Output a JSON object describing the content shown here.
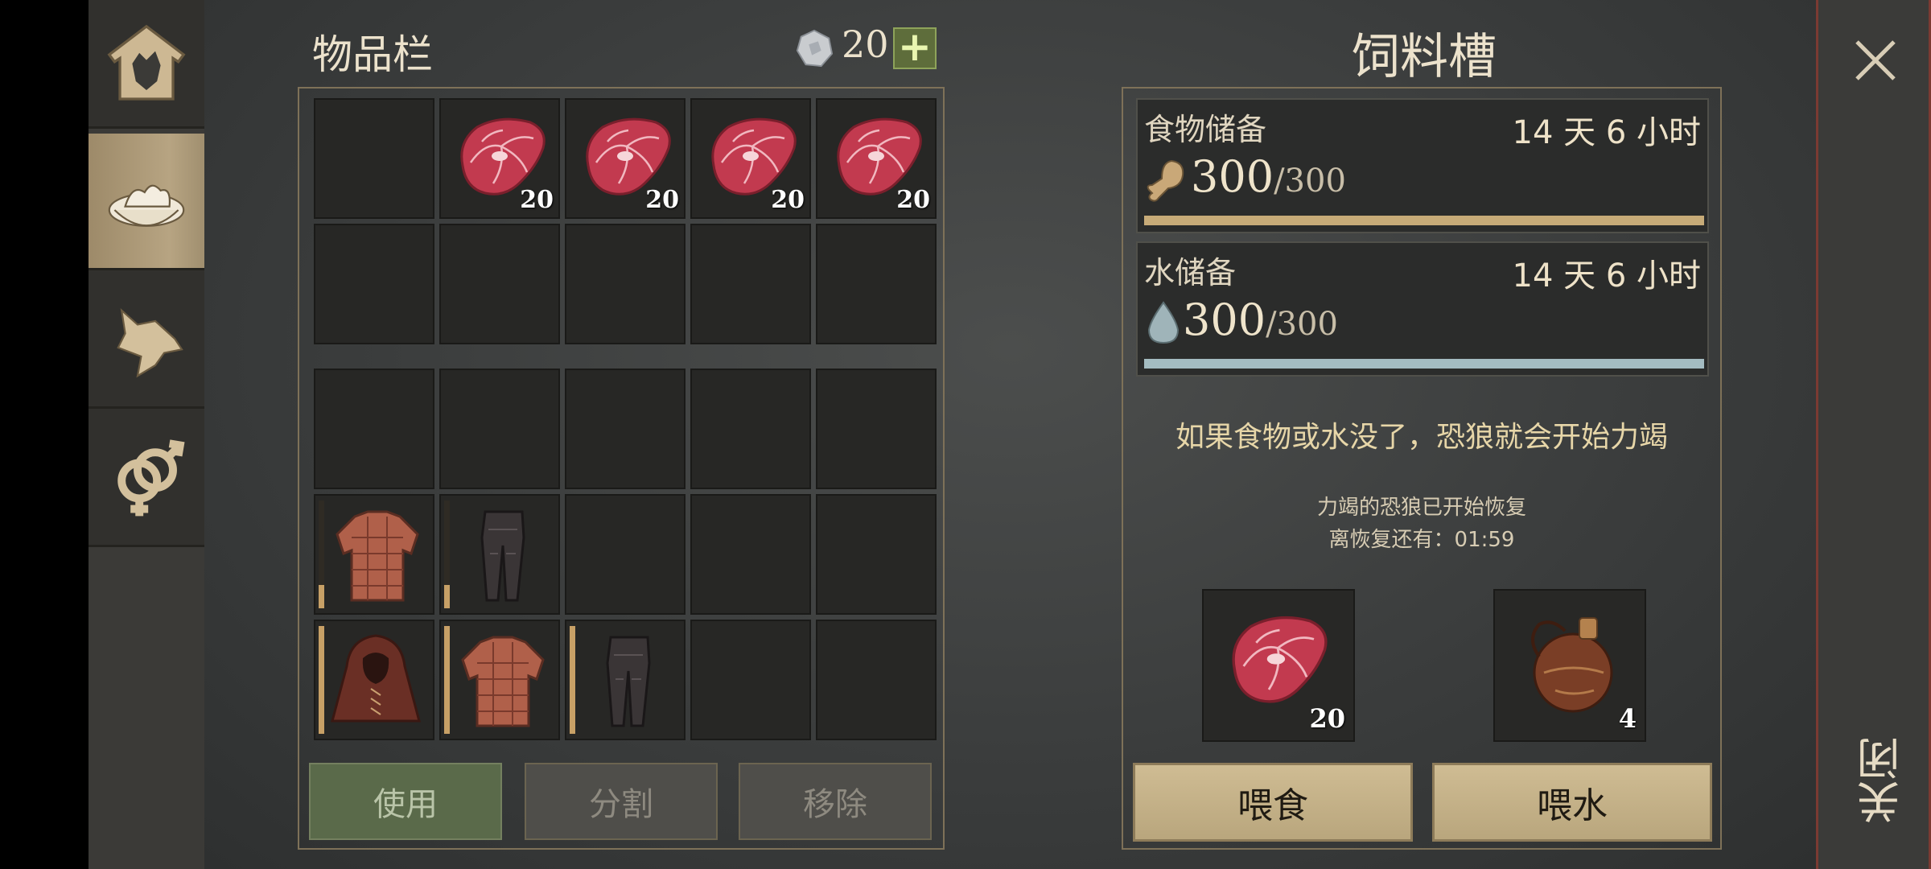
{
  "inventory": {
    "title": "物品栏",
    "currency": "20",
    "plus": "+",
    "food_slots": [
      {
        "count": "20"
      },
      {
        "count": "20"
      },
      {
        "count": "20"
      },
      {
        "count": "20"
      }
    ],
    "buttons": {
      "use": "使用",
      "split": "分割",
      "remove": "移除"
    }
  },
  "trough": {
    "title": "饲料槽",
    "food": {
      "label": "食物储备",
      "time": "14 天 6 小时",
      "value": "300",
      "max": "/300",
      "fill": 1.0
    },
    "water": {
      "label": "水储备",
      "time": "14 天 6 小时",
      "value": "300",
      "max": "/300",
      "fill": 1.0
    },
    "warning": "如果食物或水没了，恐狼就会开始力竭",
    "recovery_line1": "力竭的恐狼已开始恢复",
    "recovery_line2": "离恢复还有：01:59",
    "meat_count": "20",
    "flask_count": "4",
    "feed_button": "喂食",
    "water_button": "喂水"
  },
  "close": {
    "label": "关闭"
  },
  "colors": {
    "food_bar": "#c7ab78",
    "water_bar": "#a4bcc1",
    "accent_green": "#5e6d3b"
  }
}
